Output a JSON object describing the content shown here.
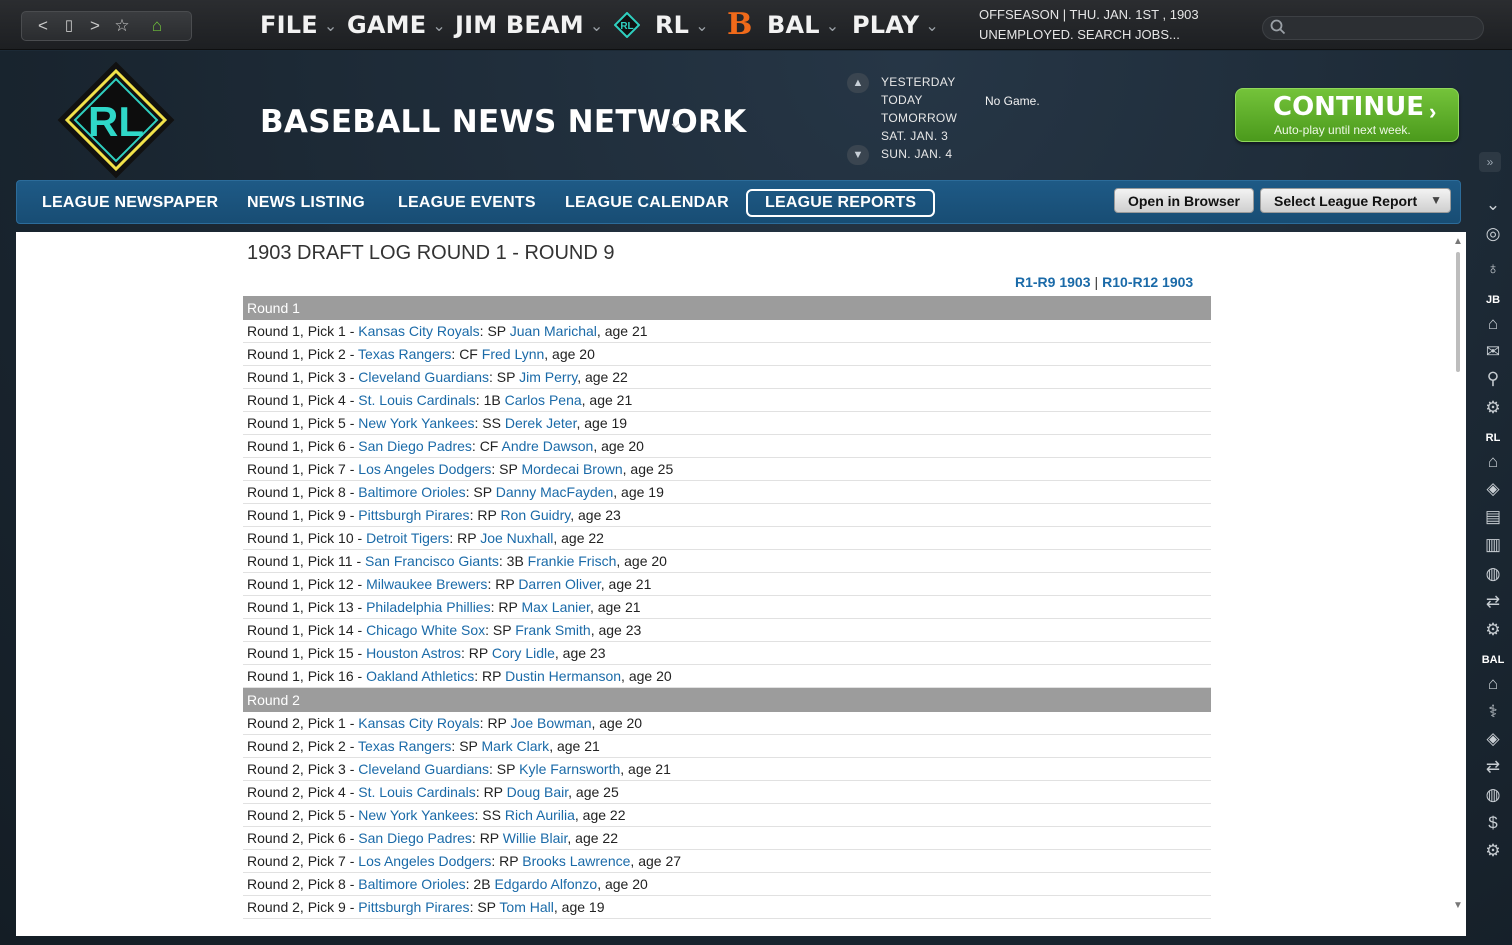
{
  "topbar": {
    "nav_buttons": [
      "<",
      "▯",
      ">",
      "☆",
      "⌂"
    ],
    "menus": [
      "FILE",
      "GAME",
      "JIM BEAM",
      "RL",
      "BAL",
      "PLAY"
    ],
    "status_line1": "OFFSEASON  |  THU. JAN. 1ST , 1903",
    "status_line2": "UNEMPLOYED. SEARCH JOBS...",
    "search_placeholder": ""
  },
  "header": {
    "logo_text": "RL",
    "network_title": "BASEBALL NEWS NETWORK",
    "days": [
      "YESTERDAY",
      "TODAY",
      "TOMORROW",
      "SAT. JAN. 3",
      "SUN. JAN. 4"
    ],
    "no_game": "No Game.",
    "continue_label": "CONTINUE",
    "continue_sub": "Auto-play until next week."
  },
  "tabs": [
    "LEAGUE NEWSPAPER",
    "NEWS LISTING",
    "LEAGUE EVENTS",
    "LEAGUE CALENDAR",
    "LEAGUE REPORTS"
  ],
  "buttons": {
    "open_browser": "Open in Browser",
    "select_report": "Select League Report"
  },
  "report": {
    "title": "1903 DRAFT LOG ROUND 1 - ROUND 9",
    "link1": "R1-R9 1903",
    "link2": "R10-R12 1903",
    "rounds": [
      {
        "header": "Round 1",
        "picks": [
          {
            "label": "Round 1, Pick 1 - ",
            "team": "Kansas City Royals",
            "pos": ": SP ",
            "player": "Juan Marichal",
            "age": ", age 21"
          },
          {
            "label": "Round 1, Pick 2 - ",
            "team": "Texas Rangers",
            "pos": ": CF ",
            "player": "Fred Lynn",
            "age": ", age 20"
          },
          {
            "label": "Round 1, Pick 3 - ",
            "team": "Cleveland Guardians",
            "pos": ": SP ",
            "player": "Jim Perry",
            "age": ", age 22"
          },
          {
            "label": "Round 1, Pick 4 - ",
            "team": "St. Louis Cardinals",
            "pos": ": 1B ",
            "player": "Carlos Pena",
            "age": ", age 21"
          },
          {
            "label": "Round 1, Pick 5 - ",
            "team": "New York Yankees",
            "pos": ": SS ",
            "player": "Derek Jeter",
            "age": ", age 19"
          },
          {
            "label": "Round 1, Pick 6 - ",
            "team": "San Diego Padres",
            "pos": ": CF ",
            "player": "Andre Dawson",
            "age": ", age 20"
          },
          {
            "label": "Round 1, Pick 7 - ",
            "team": "Los Angeles Dodgers",
            "pos": ": SP ",
            "player": "Mordecai Brown",
            "age": ", age 25"
          },
          {
            "label": "Round 1, Pick 8 - ",
            "team": "Baltimore Orioles",
            "pos": ": SP ",
            "player": "Danny MacFayden",
            "age": ", age 19"
          },
          {
            "label": "Round 1, Pick 9 - ",
            "team": "Pittsburgh Pirares",
            "pos": ": RP ",
            "player": "Ron Guidry",
            "age": ", age 23"
          },
          {
            "label": "Round 1, Pick 10 - ",
            "team": "Detroit Tigers",
            "pos": ": RP ",
            "player": "Joe Nuxhall",
            "age": ", age 22"
          },
          {
            "label": "Round 1, Pick 11 - ",
            "team": "San Francisco Giants",
            "pos": ": 3B ",
            "player": "Frankie Frisch",
            "age": ", age 20"
          },
          {
            "label": "Round 1, Pick 12 - ",
            "team": "Milwaukee Brewers",
            "pos": ": RP ",
            "player": "Darren Oliver",
            "age": ", age 21"
          },
          {
            "label": "Round 1, Pick 13 - ",
            "team": "Philadelphia Phillies",
            "pos": ": RP ",
            "player": "Max Lanier",
            "age": ", age 21"
          },
          {
            "label": "Round 1, Pick 14 - ",
            "team": "Chicago White Sox",
            "pos": ": SP ",
            "player": "Frank Smith",
            "age": ", age 23"
          },
          {
            "label": "Round 1, Pick 15 - ",
            "team": "Houston Astros",
            "pos": ": RP ",
            "player": "Cory Lidle",
            "age": ", age 23"
          },
          {
            "label": "Round 1, Pick 16 - ",
            "team": "Oakland Athletics",
            "pos": ": RP ",
            "player": "Dustin Hermanson",
            "age": ", age 20"
          }
        ]
      },
      {
        "header": "Round 2",
        "picks": [
          {
            "label": "Round 2, Pick 1 - ",
            "team": "Kansas City Royals",
            "pos": ": RP ",
            "player": "Joe Bowman",
            "age": ", age 20"
          },
          {
            "label": "Round 2, Pick 2 - ",
            "team": "Texas Rangers",
            "pos": ": SP ",
            "player": "Mark Clark",
            "age": ", age 21"
          },
          {
            "label": "Round 2, Pick 3 - ",
            "team": "Cleveland Guardians",
            "pos": ": SP ",
            "player": "Kyle Farnsworth",
            "age": ", age 21"
          },
          {
            "label": "Round 2, Pick 4 - ",
            "team": "St. Louis Cardinals",
            "pos": ": RP ",
            "player": "Doug Bair",
            "age": ", age 25"
          },
          {
            "label": "Round 2, Pick 5 - ",
            "team": "New York Yankees",
            "pos": ": SS ",
            "player": "Rich Aurilia",
            "age": ", age 22"
          },
          {
            "label": "Round 2, Pick 6 - ",
            "team": "San Diego Padres",
            "pos": ": RP ",
            "player": "Willie Blair",
            "age": ", age 22"
          },
          {
            "label": "Round 2, Pick 7 - ",
            "team": "Los Angeles Dodgers",
            "pos": ": RP ",
            "player": "Brooks Lawrence",
            "age": ", age 27"
          },
          {
            "label": "Round 2, Pick 8 - ",
            "team": "Baltimore Orioles",
            "pos": ": 2B ",
            "player": "Edgardo Alfonzo",
            "age": ", age 20"
          },
          {
            "label": "Round 2, Pick 9 - ",
            "team": "Pittsburgh Pirares",
            "pos": ": SP ",
            "player": "Tom Hall",
            "age": ", age 19"
          }
        ]
      }
    ]
  },
  "sidebar": {
    "labels": [
      "JB",
      "RL",
      "BAL"
    ],
    "icons": [
      "chevron-down-icon",
      "globe-icon",
      "lightbulb-icon",
      "home-icon",
      "mail-icon",
      "search-icon",
      "gear-icon",
      "home-icon",
      "diamond-icon",
      "newspaper-icon",
      "bar-chart-icon",
      "baseball-icon",
      "transactions-icon",
      "gear-icon",
      "home-icon",
      "stethoscope-icon",
      "diamond-icon",
      "transactions-icon",
      "baseball-icon",
      "dollar-icon",
      "gear-icon"
    ]
  },
  "colors": {
    "link": "#1a6aa8",
    "continue": "#5fae2b",
    "tabbar": "#1e5a86",
    "round_header": "#9c9c9c",
    "bal_orange": "#f06a1a"
  }
}
